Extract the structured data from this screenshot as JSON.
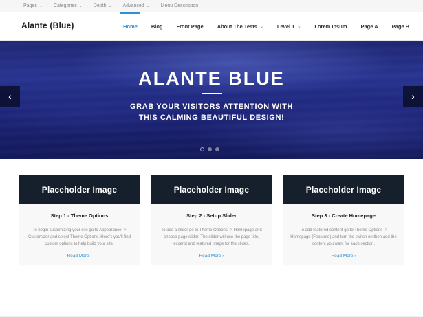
{
  "topbar": {
    "items": [
      {
        "label": "Pages",
        "has_chevron": true
      },
      {
        "label": "Categories",
        "has_chevron": true
      },
      {
        "label": "Depth",
        "has_chevron": true
      },
      {
        "label": "Advanced",
        "has_chevron": true
      },
      {
        "label": "Menu Description",
        "has_chevron": false
      }
    ],
    "chevron_glyph": "⌄"
  },
  "header": {
    "logo": "Alante (Blue)",
    "nav": [
      {
        "label": "Home",
        "active": true
      },
      {
        "label": "Blog"
      },
      {
        "label": "Front Page"
      },
      {
        "label": "About The Tests",
        "has_chevron": true
      },
      {
        "label": "Level 1",
        "has_chevron": true
      },
      {
        "label": "Lorem Ipsum"
      },
      {
        "label": "Page A"
      },
      {
        "label": "Page B"
      }
    ],
    "chevron_glyph": "⌄",
    "accent_color": "#2f8fd5"
  },
  "hero": {
    "title": "ALANTE BLUE",
    "subtitle_line1": "GRAB YOUR VISITORS ATTENTION WITH",
    "subtitle_line2": "THIS CALMING BEAUTIFUL DESIGN!",
    "prev_glyph": "‹",
    "next_glyph": "›",
    "slide_count": 3,
    "active_slide": 1
  },
  "features": [
    {
      "image_label": "Placeholder Image",
      "title": "Step 1 - Theme Options",
      "text": "To begin customizing your site go to Appearance -> Customizer and select Theme Options. Here's you'll find custom options to help build your site.",
      "link": "Read More ›"
    },
    {
      "image_label": "Placeholder Image",
      "title": "Step 2 - Setup Slider",
      "text": "To add a slider go to Theme Options -> Homepage and choose page slider. The slider will use the page title, excerpt and featured image for the slides.",
      "link": "Read More ›"
    },
    {
      "image_label": "Placeholder Image",
      "title": "Step 3 - Create Homepage",
      "text": "To add featured content go to Theme Options -> Homepage (Featured) and turn the switch on then add the content you want for each section.",
      "link": "Read More ›"
    }
  ]
}
